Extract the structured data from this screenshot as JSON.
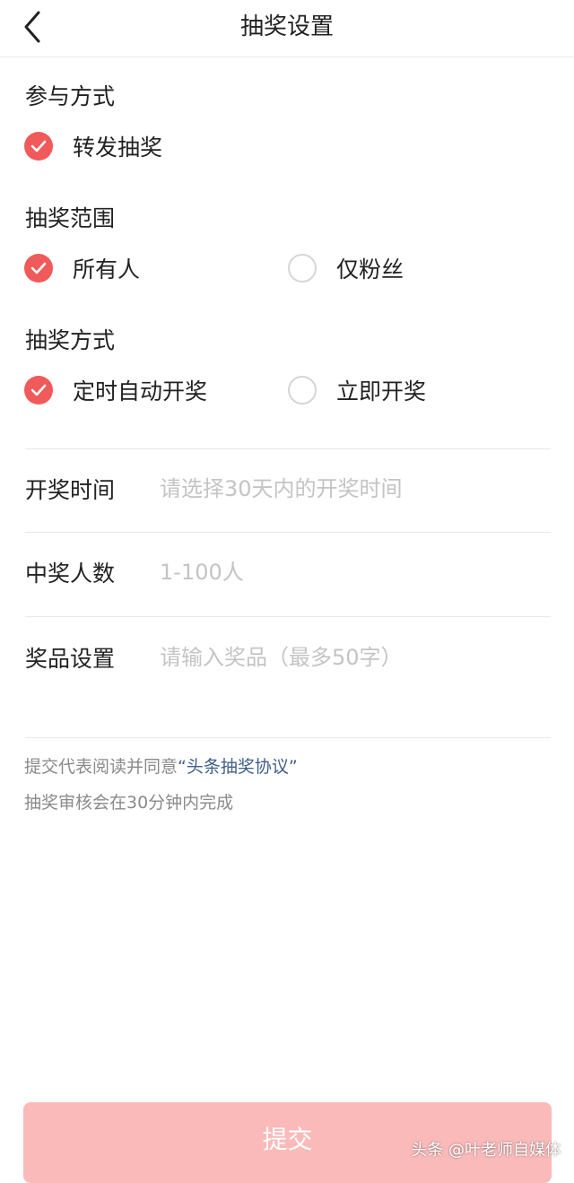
{
  "header": {
    "title": "抽奖设置"
  },
  "participation": {
    "title": "参与方式",
    "options": [
      {
        "label": "转发抽奖",
        "checked": true
      }
    ]
  },
  "scope": {
    "title": "抽奖范围",
    "options": [
      {
        "label": "所有人",
        "checked": true
      },
      {
        "label": "仅粉丝",
        "checked": false
      }
    ]
  },
  "draw_method": {
    "title": "抽奖方式",
    "options": [
      {
        "label": "定时自动开奖",
        "checked": true
      },
      {
        "label": "立即开奖",
        "checked": false
      }
    ]
  },
  "fields": {
    "draw_time": {
      "label": "开奖时间",
      "value": "",
      "placeholder": "请选择30天内的开奖时间"
    },
    "winners": {
      "label": "中奖人数",
      "value": "",
      "placeholder": "1-100人"
    },
    "prize": {
      "label": "奖品设置",
      "value": "",
      "placeholder": "请输入奖品（最多50字）"
    }
  },
  "notes": {
    "agreement_prefix": "提交代表阅读并同意",
    "agreement_link": "“头条抽奖协议”",
    "review": "抽奖审核会在30分钟内完成"
  },
  "submit": {
    "label": "提交"
  },
  "watermark": "头条 @叶老师自媒体",
  "colors": {
    "accent": "#f05a5a",
    "submit_disabled": "#fbbaba",
    "link": "#3f5f8a"
  }
}
